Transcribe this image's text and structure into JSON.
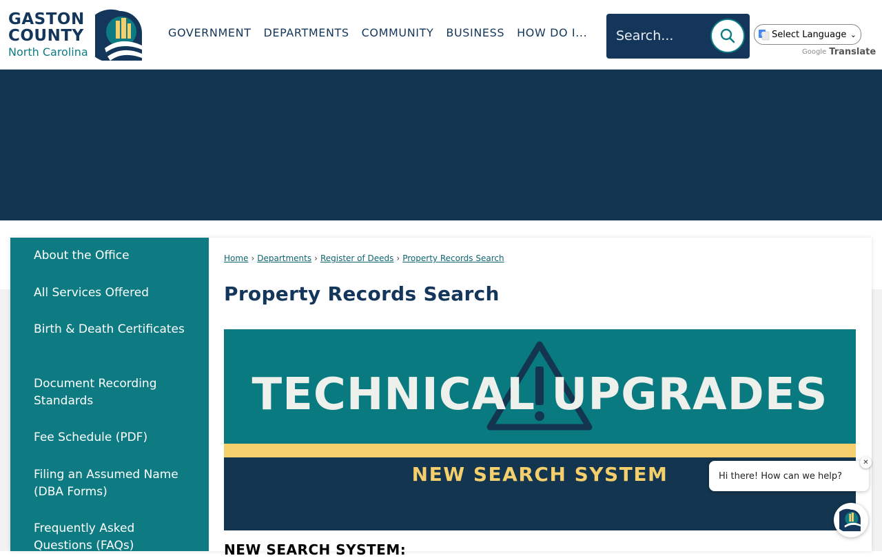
{
  "header": {
    "logo": {
      "line1": "GASTON",
      "line2": "COUNTY",
      "line3": "North Carolina"
    },
    "nav": [
      {
        "label": "GOVERNMENT"
      },
      {
        "label": "DEPARTMENTS"
      },
      {
        "label": "COMMUNITY"
      },
      {
        "label": "BUSINESS"
      },
      {
        "label": "HOW DO I..."
      }
    ],
    "search": {
      "placeholder": "Search..."
    },
    "translate": {
      "select_label": "Select Language",
      "powered_by": "Google",
      "translate_label": "Translate"
    }
  },
  "sidebar": {
    "items": [
      {
        "label": "About the Office"
      },
      {
        "label": "All Services Offered"
      },
      {
        "label": "Birth & Death Certificates"
      },
      {
        "label": "Document Recording Standards"
      },
      {
        "label": "Fee Schedule (PDF)"
      },
      {
        "label": "Filing an Assumed Name (DBA Forms)"
      },
      {
        "label": "Frequently Asked Questions (FAQs)"
      }
    ]
  },
  "breadcrumb": [
    {
      "label": "Home"
    },
    {
      "label": "Departments"
    },
    {
      "label": "Register of Deeds"
    },
    {
      "label": "Property Records Search"
    }
  ],
  "page_title": "Property Records Search",
  "promo": {
    "headline": "TECHNICAL UPGRADES",
    "subline": "NEW SEARCH SYSTEM"
  },
  "section_heading": "NEW SEARCH SYSTEM:",
  "chat": {
    "greeting": "Hi there! How can we help?",
    "close": "✕"
  },
  "colors": {
    "navy": "#13365a",
    "teal": "#0e7b82",
    "banner": "#13354f",
    "yellow": "#f4cf6b"
  }
}
